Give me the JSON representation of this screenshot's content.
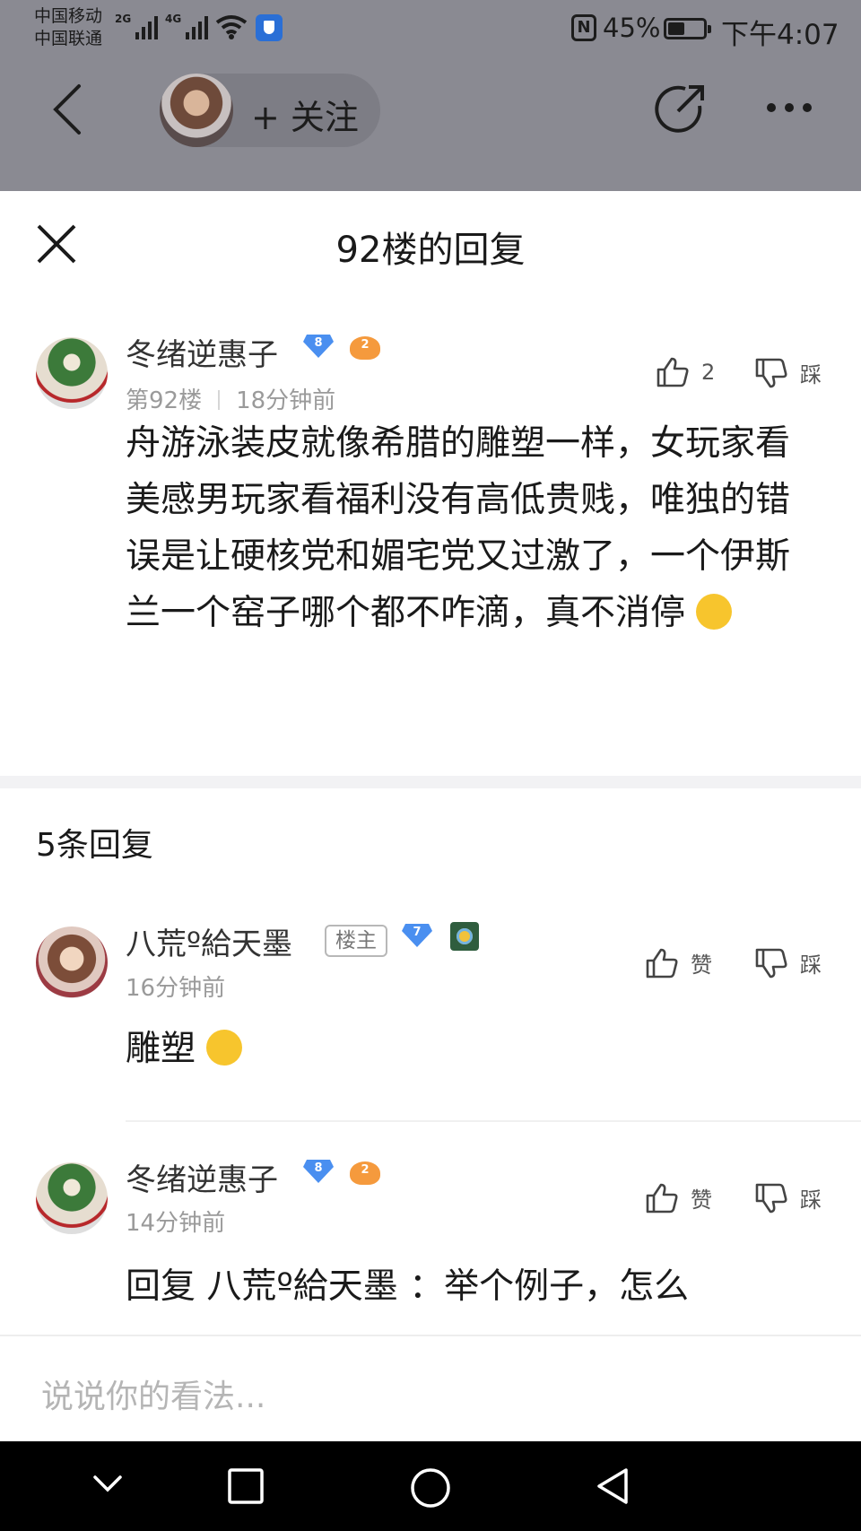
{
  "status_bar": {
    "carrier1": "中国移动",
    "carrier2": "中国联通",
    "net1": "2G",
    "net2": "4G",
    "nfc": "N",
    "battery_pct": "45%",
    "battery_level": 0.45,
    "time": "下午4:07"
  },
  "topnav": {
    "follow_label": "+ 关注",
    "icons": [
      "back-icon",
      "share-icon",
      "more-icon"
    ]
  },
  "sheet": {
    "title": "92楼的回复"
  },
  "main_post": {
    "username": "冬绪逆惠子",
    "level": "8",
    "badge": "2",
    "floor": "第92楼",
    "time": "18分钟前",
    "like_count": "2",
    "dislike_label": "踩",
    "content": "舟游泳装皮就像希腊的雕塑一样，女玩家看美感男玩家看福利没有高低贵贱，唯独的错误是让硬核党和媚宅党又过激了，一个伊斯兰一个窑子哪个都不咋滴，真不消停"
  },
  "replies_header": "5条回复",
  "replies": [
    {
      "username": "八荒º給天墨",
      "tag": "楼主",
      "level": "7",
      "time": "16分钟前",
      "like_label": "赞",
      "dislike_label": "踩",
      "content": "雕塑"
    },
    {
      "username": "冬绪逆惠子",
      "level": "8",
      "badge": "2",
      "time": "14分钟前",
      "like_label": "赞",
      "dislike_label": "踩",
      "content": "回复 八荒º給天墨 ：举个例子，怎么"
    }
  ],
  "input": {
    "placeholder": "说说你的看法..."
  },
  "colors": {
    "dim_overlay": "#8a8a92",
    "level_badge": "#4a8ff0",
    "orange_badge": "#f59a3d"
  }
}
